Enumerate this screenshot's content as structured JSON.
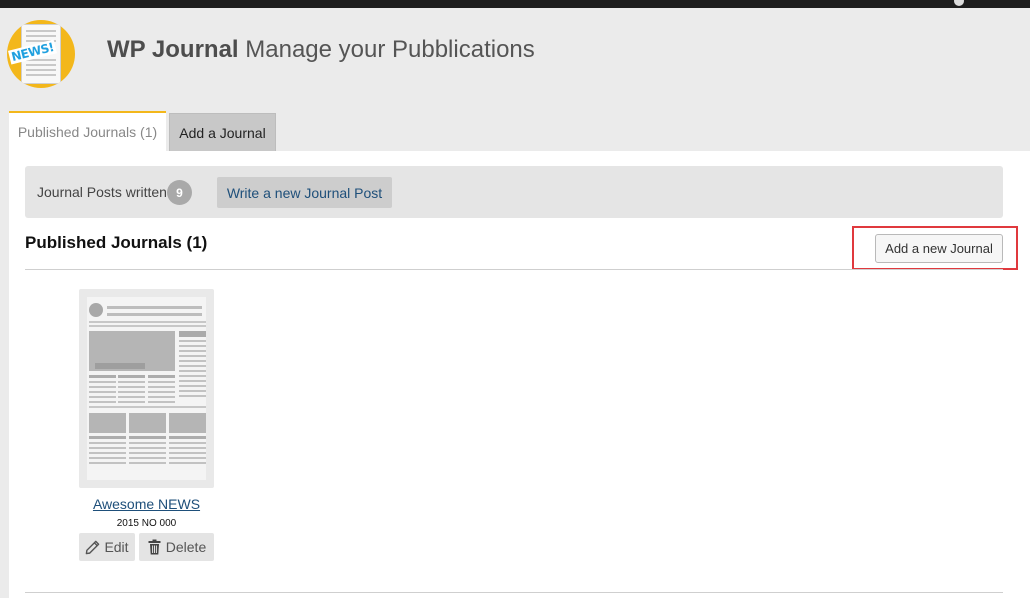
{
  "header": {
    "logo_badge": "NEWS!",
    "app_name": "WP Journal",
    "subtitle": "Manage your Pubblications"
  },
  "tabs": [
    {
      "label": "Published Journals (1)",
      "active": true
    },
    {
      "label": "Add a Journal",
      "active": false
    }
  ],
  "stats": {
    "label": "Journal Posts written",
    "count": "9",
    "write_button": "Write a new Journal Post"
  },
  "section": {
    "title": "Published Journals (1)",
    "add_button": "Add a new Journal"
  },
  "journals": [
    {
      "name": "Awesome NEWS",
      "subtitle": "2015 NO 000",
      "edit_label": "Edit",
      "delete_label": "Delete"
    }
  ],
  "colors": {
    "accent": "#f3b71b",
    "link": "#1e4f7a",
    "highlight": "#e0393e",
    "logo_text": "#1fa0df"
  },
  "icons": {
    "edit": "pencil-icon",
    "delete": "trash-icon"
  }
}
